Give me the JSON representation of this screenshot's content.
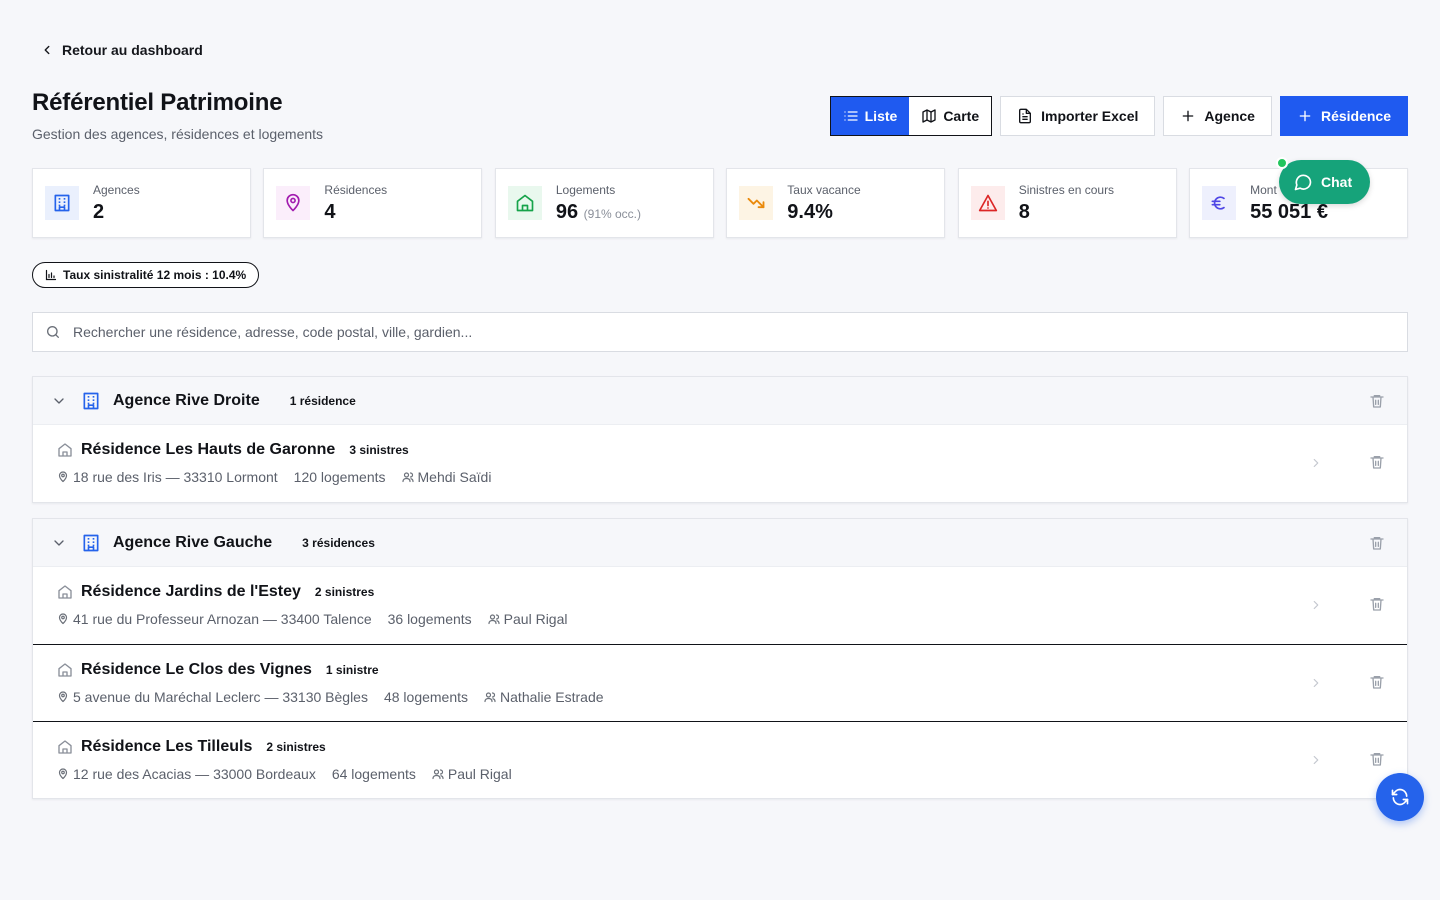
{
  "nav": {
    "back_label": "Retour au dashboard"
  },
  "header": {
    "title": "Référentiel Patrimoine",
    "subtitle": "Gestion des agences, résidences et logements"
  },
  "toolbar": {
    "view_list_label": "Liste",
    "view_map_label": "Carte",
    "active_view": "Liste",
    "import_label": "Importer Excel",
    "add_agency_label": "Agence",
    "add_residence_label": "Résidence"
  },
  "stats": [
    {
      "label": "Agences",
      "value": "2",
      "icon": "building-icon",
      "color": "#2563eb",
      "bg": "#eaf0fd"
    },
    {
      "label": "Résidences",
      "value": "4",
      "icon": "map-pin-icon",
      "color": "#a21caf",
      "bg": "#fbeefb"
    },
    {
      "label": "Logements",
      "value": "96",
      "suffix": "(91% occ.)",
      "icon": "home-icon",
      "color": "#16a34a",
      "bg": "#e9f8ee"
    },
    {
      "label": "Taux vacance",
      "value": "9.4%",
      "icon": "trending-down-icon",
      "color": "#ea8a0c",
      "bg": "#fdf4e4"
    },
    {
      "label": "Sinistres en cours",
      "value": "8",
      "icon": "alert-triangle-icon",
      "color": "#dc2626",
      "bg": "#fdecec"
    },
    {
      "label": "Mont",
      "value": "55 051 €",
      "icon": "euro-icon",
      "color": "#4f46e5",
      "bg": "#eef0fd"
    }
  ],
  "chat": {
    "label": "Chat",
    "color": "#16a37a"
  },
  "claims_rate_pill": "Taux sinistralité 12 mois : 10.4%",
  "search": {
    "placeholder": "Rechercher une résidence, adresse, code postal, ville, gardien...",
    "value": ""
  },
  "agencies": [
    {
      "name": "Agence Rive Droite",
      "count_label": "1 résidence",
      "residences": [
        {
          "name": "Résidence Les Hauts de Garonne",
          "claims": "3 sinistres",
          "address": "18 rue des Iris — 33310 Lormont",
          "units": "120 logements",
          "keeper": "Mehdi Saïdi"
        }
      ]
    },
    {
      "name": "Agence Rive Gauche",
      "count_label": "3 résidences",
      "residences": [
        {
          "name": "Résidence Jardins de l'Estey",
          "claims": "2 sinistres",
          "address": "41 rue du Professeur Arnozan — 33400 Talence",
          "units": "36 logements",
          "keeper": "Paul Rigal"
        },
        {
          "name": "Résidence Le Clos des Vignes",
          "claims": "1 sinistre",
          "address": "5 avenue du Maréchal Leclerc — 33130 Bègles",
          "units": "48 logements",
          "keeper": "Nathalie Estrade"
        },
        {
          "name": "Résidence Les Tilleuls",
          "claims": "2 sinistres",
          "address": "12 rue des Acacias — 33000 Bordeaux",
          "units": "64 logements",
          "keeper": "Paul Rigal"
        }
      ]
    }
  ]
}
